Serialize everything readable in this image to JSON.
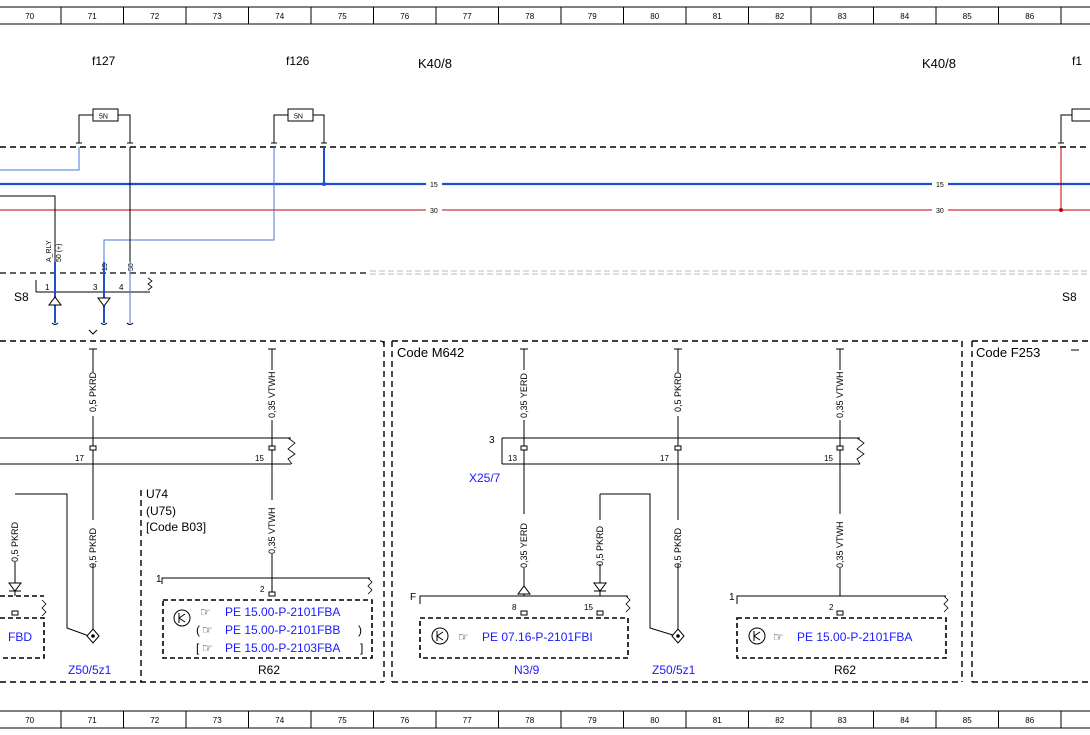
{
  "ruler": {
    "columns": [
      "70",
      "71",
      "72",
      "73",
      "74",
      "75",
      "76",
      "77",
      "78",
      "79",
      "80",
      "81",
      "82",
      "83",
      "84",
      "85",
      "86"
    ]
  },
  "labels": {
    "f127": "f127",
    "f126": "f126",
    "k40_left": "K40/8",
    "k40_right": "K40/8",
    "f_cut": "f1",
    "fuse_rating": "5N",
    "bus_15": "15",
    "bus_30": "30",
    "s8_left": "S8",
    "s8_right": "S8",
    "pin_a_rly": "A_RLY",
    "pin_50plus": "50 (+)",
    "pin_15": "15",
    "pin_50": "50",
    "s8_pin1": "1",
    "s8_pin3": "3",
    "s8_pin4": "4",
    "code_m642": "Code M642",
    "code_f253": "Code F253",
    "u74": "U74",
    "u75": "(U75)",
    "code_b03": "[Code B03]",
    "x25_7": "X25/7",
    "x25_pin3": "3",
    "r62_left": "R62",
    "r62_right": "R62",
    "n3_9": "N3/9",
    "z50_left": "Z50/5z1",
    "z50_right": "Z50/5z1",
    "fbd_frag": "FBD",
    "f_pin": "F"
  },
  "wires": {
    "w_05pkrd": "0,5 PKRD",
    "w_035vtwh": "0,35 VTWH",
    "w_035yerd": "0,35 YERD"
  },
  "pins": {
    "p17": "17",
    "p15": "15",
    "p13": "13",
    "p1": "1",
    "p2": "2",
    "p8": "8",
    "p15b": "15"
  },
  "refs": {
    "r62_left_1": "PE 15.00-P-2101FBA",
    "r62_left_2": "PE 15.00-P-2101FBB",
    "r62_left_3": "PE 15.00-P-2103FBA",
    "n3_9": "PE 07.16-P-2101FBI",
    "r62_right": "PE 15.00-P-2101FBA"
  },
  "colors": {
    "bus15": "#1f4fd1",
    "bus30": "#c00000",
    "link": "#1a1aff",
    "light_wire": "#4a78d8"
  }
}
